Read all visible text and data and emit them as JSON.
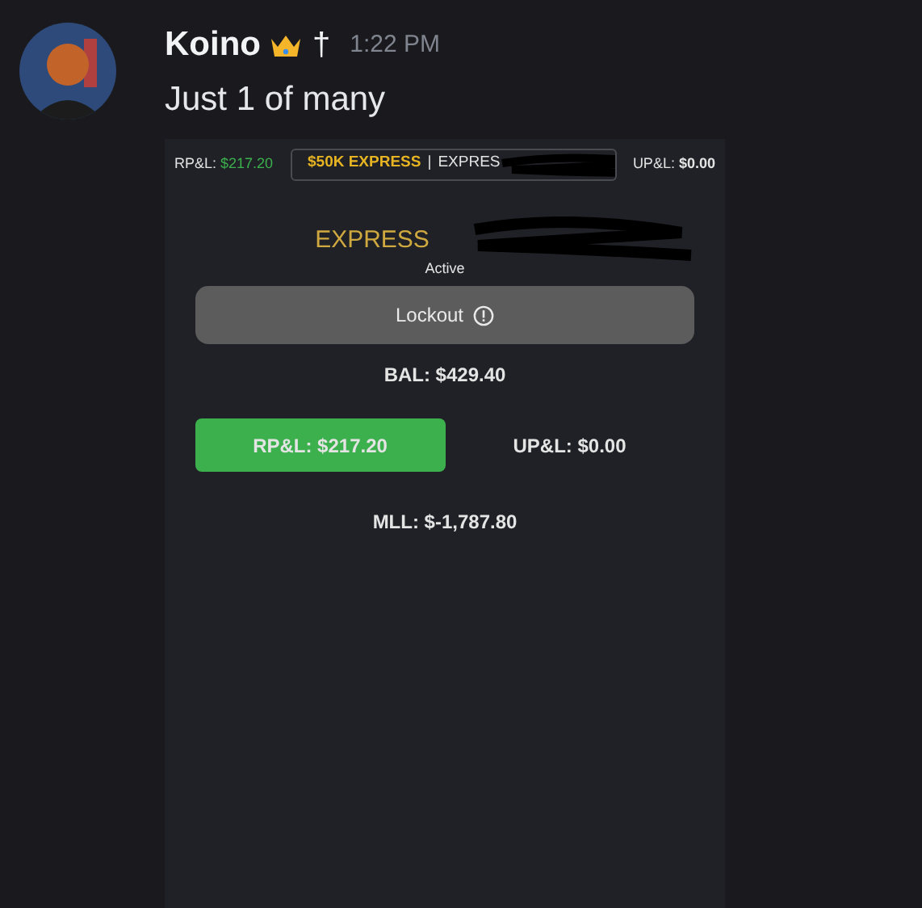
{
  "message": {
    "author": "Koino",
    "badge": "†",
    "time": "1:22 PM",
    "text": "Just 1 of many"
  },
  "account_panel": {
    "top_bar": {
      "rpl_label": "RP&L:",
      "rpl_value": "$217.20",
      "account_selector": {
        "plan": "$50K EXPRESS",
        "separator": "|",
        "account": "EXPRES"
      },
      "upl_label": "UP&L:",
      "upl_value": "$0.00"
    },
    "account_name": "EXPRESS",
    "status": "Active",
    "lockout_button": "Lockout",
    "balance": "BAL: $429.40",
    "pnl_tabs": [
      {
        "label": "RP&L: $217.20",
        "selected": true
      },
      {
        "label": "UP&L: $0.00",
        "selected": false
      }
    ],
    "mll": "MLL: $-1,787.80"
  }
}
